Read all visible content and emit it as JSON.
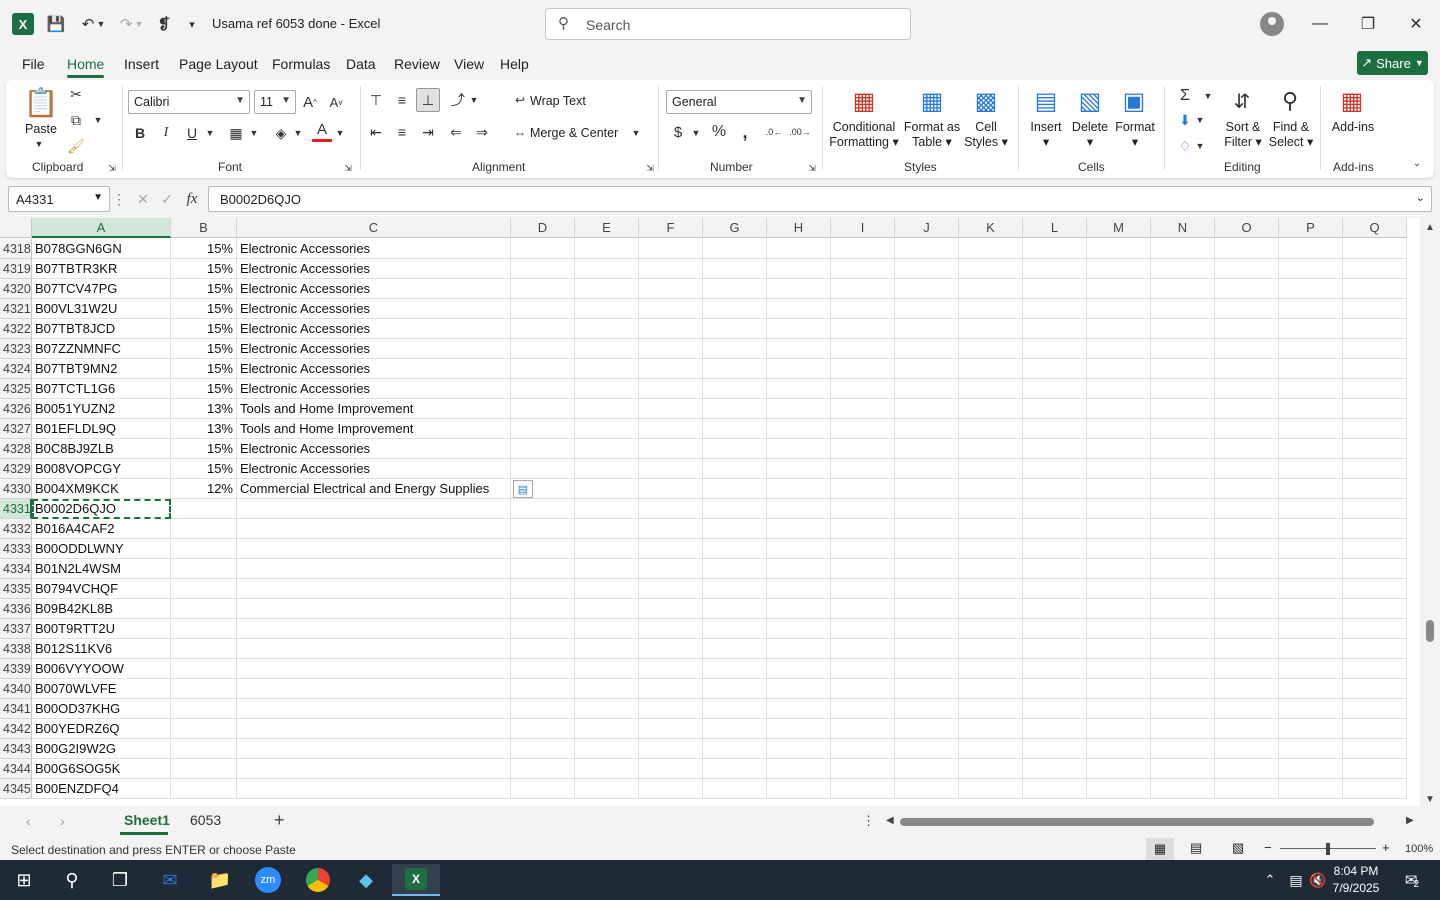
{
  "app": {
    "title": "Usama ref 6053 done  -  Excel",
    "search_placeholder": "Search",
    "share_label": "Share"
  },
  "menu": [
    "File",
    "Home",
    "Insert",
    "Page Layout",
    "Formulas",
    "Data",
    "Review",
    "View",
    "Help"
  ],
  "ribbon": {
    "clipboard": {
      "label": "Clipboard",
      "paste": "Paste"
    },
    "font": {
      "label": "Font",
      "name": "Calibri",
      "size": "11"
    },
    "alignment": {
      "label": "Alignment",
      "wrap": "Wrap Text",
      "merge": "Merge & Center"
    },
    "number": {
      "label": "Number",
      "format": "General"
    },
    "styles": {
      "label": "Styles",
      "cond1": "Conditional",
      "cond2": "Formatting",
      "fmt1": "Format as",
      "fmt2": "Table",
      "cell1": "Cell",
      "cell2": "Styles"
    },
    "cells": {
      "label": "Cells",
      "insert": "Insert",
      "delete": "Delete",
      "format": "Format"
    },
    "editing": {
      "label": "Editing",
      "sort1": "Sort &",
      "sort2": "Filter",
      "find1": "Find &",
      "find2": "Select"
    },
    "addins": {
      "label": "Add-ins",
      "btn": "Add-ins"
    }
  },
  "formula_bar": {
    "name_box": "A4331",
    "formula": "B0002D6QJO",
    "fx": "fx"
  },
  "columns": [
    "A",
    "B",
    "C",
    "D",
    "E",
    "F",
    "G",
    "H",
    "I",
    "J",
    "K",
    "L",
    "M",
    "N",
    "O",
    "P",
    "Q"
  ],
  "rows": [
    {
      "n": "4318",
      "a": "B078GGN6GN",
      "b": "15%",
      "c": "Electronic Accessories"
    },
    {
      "n": "4319",
      "a": "B07TBTR3KR",
      "b": "15%",
      "c": "Electronic Accessories"
    },
    {
      "n": "4320",
      "a": "B07TCV47PG",
      "b": "15%",
      "c": "Electronic Accessories"
    },
    {
      "n": "4321",
      "a": "B00VL31W2U",
      "b": "15%",
      "c": "Electronic Accessories"
    },
    {
      "n": "4322",
      "a": "B07TBT8JCD",
      "b": "15%",
      "c": "Electronic Accessories"
    },
    {
      "n": "4323",
      "a": "B07ZZNMNFC",
      "b": "15%",
      "c": "Electronic Accessories"
    },
    {
      "n": "4324",
      "a": "B07TBT9MN2",
      "b": "15%",
      "c": "Electronic Accessories"
    },
    {
      "n": "4325",
      "a": "B07TCTL1G6",
      "b": "15%",
      "c": "Electronic Accessories"
    },
    {
      "n": "4326",
      "a": "B0051YUZN2",
      "b": "13%",
      "c": "Tools and Home Improvement"
    },
    {
      "n": "4327",
      "a": "B01EFLDL9Q",
      "b": "13%",
      "c": "Tools and Home Improvement"
    },
    {
      "n": "4328",
      "a": "B0C8BJ9ZLB",
      "b": "15%",
      "c": "Electronic Accessories"
    },
    {
      "n": "4329",
      "a": "B008VOPCGY",
      "b": "15%",
      "c": "Electronic Accessories"
    },
    {
      "n": "4330",
      "a": "B004XM9KCK",
      "b": "12%",
      "c": "Commercial Electrical and Energy Supplies"
    },
    {
      "n": "4331",
      "a": "B0002D6QJO",
      "b": "",
      "c": ""
    },
    {
      "n": "4332",
      "a": "B016A4CAF2",
      "b": "",
      "c": ""
    },
    {
      "n": "4333",
      "a": "B00ODDLWNY",
      "b": "",
      "c": ""
    },
    {
      "n": "4334",
      "a": "B01N2L4WSM",
      "b": "",
      "c": ""
    },
    {
      "n": "4335",
      "a": "B0794VCHQF",
      "b": "",
      "c": ""
    },
    {
      "n": "4336",
      "a": "B09B42KL8B",
      "b": "",
      "c": ""
    },
    {
      "n": "4337",
      "a": "B00T9RTT2U",
      "b": "",
      "c": ""
    },
    {
      "n": "4338",
      "a": "B012S11KV6",
      "b": "",
      "c": ""
    },
    {
      "n": "4339",
      "a": "B006VYYOOW",
      "b": "",
      "c": ""
    },
    {
      "n": "4340",
      "a": "B0070WLVFE",
      "b": "",
      "c": ""
    },
    {
      "n": "4341",
      "a": "B00OD37KHG",
      "b": "",
      "c": ""
    },
    {
      "n": "4342",
      "a": "B00YEDRZ6Q",
      "b": "",
      "c": ""
    },
    {
      "n": "4343",
      "a": "B00G2I9W2G",
      "b": "",
      "c": ""
    },
    {
      "n": "4344",
      "a": "B00G6SOG5K",
      "b": "",
      "c": ""
    },
    {
      "n": "4345",
      "a": "B00ENZDFQ4",
      "b": "",
      "c": ""
    }
  ],
  "sheets": [
    "Sheet1",
    "6053"
  ],
  "status": {
    "message": "Select destination and press ENTER or choose Paste",
    "zoom": "100%"
  },
  "taskbar": {
    "time": "8:04 PM",
    "date": "7/9/2025",
    "notif": "2"
  },
  "colors": {
    "accent": "#1d6f42",
    "selected_header": "#d2e7d9"
  }
}
